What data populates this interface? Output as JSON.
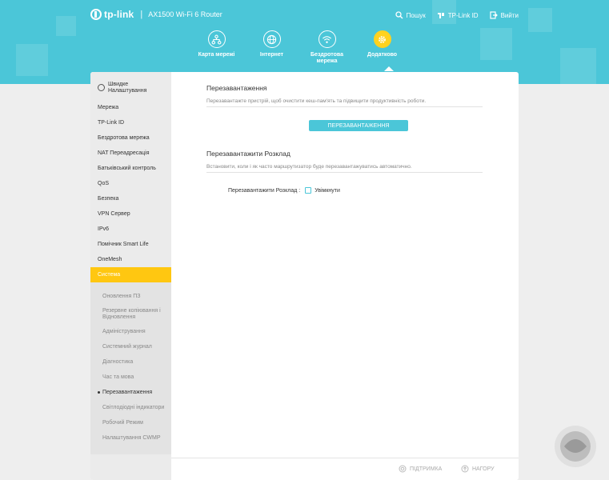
{
  "header": {
    "brand": "tp-link",
    "separator": "|",
    "model": "AX1500 Wi-Fi 6 Router",
    "links": {
      "search": "Пошук",
      "tplink_id": "TP-Link ID",
      "logout": "Вийти"
    },
    "nav": {
      "map": "Карта мережі",
      "internet": "Інтернет",
      "wireless_line1": "Бездротова",
      "wireless_line2": "мережа",
      "advanced": "Додатково"
    }
  },
  "sidebar": {
    "quick_setup_line1": "Швидке",
    "quick_setup_line2": "Налаштування",
    "items": [
      "Мережа",
      "TP-Link ID",
      "Бездротова мережа",
      "NAT Переадресація",
      "Батьківський контроль",
      "QoS",
      "Безпека",
      "VPN Сервер",
      "IPv6",
      "Помічник Smart Life",
      "OneMesh",
      "Система"
    ],
    "submenu": {
      "firmware": "Оновлення ПЗ",
      "backup_line1": "Резервне копіювання і",
      "backup_line2": "Відновлення",
      "admin": "Адміністрування",
      "syslog": "Системний журнал",
      "diagnostics": "Діагностика",
      "time_lang": "Час та мова",
      "reboot": "Перезавантаження",
      "leds": "Світлодіодні індикатори",
      "mode": "Робочий Режим",
      "cwmp": "Налаштування CWMP"
    }
  },
  "main": {
    "reboot_title": "Перезавантаження",
    "reboot_desc": "Перезавантажте пристрій, щоб очистити кеш-пам'ять та підвищити продуктивність роботи.",
    "reboot_button": "ПЕРЕЗАВАНТАЖЕННЯ",
    "schedule_title": "Перезавантажити Розклад",
    "schedule_desc": "Встановити, коли і як часто маршрутизатор буде перезавантажуватись автоматично.",
    "schedule_label": "Перезавантажити Розклад :",
    "schedule_enable": "Увімкнути",
    "schedule_enabled": false
  },
  "footer": {
    "support": "ПІДТРИМКА",
    "top": "НАГОРУ"
  },
  "colors": {
    "brand": "#4bc6d8",
    "active": "#ffc711"
  }
}
